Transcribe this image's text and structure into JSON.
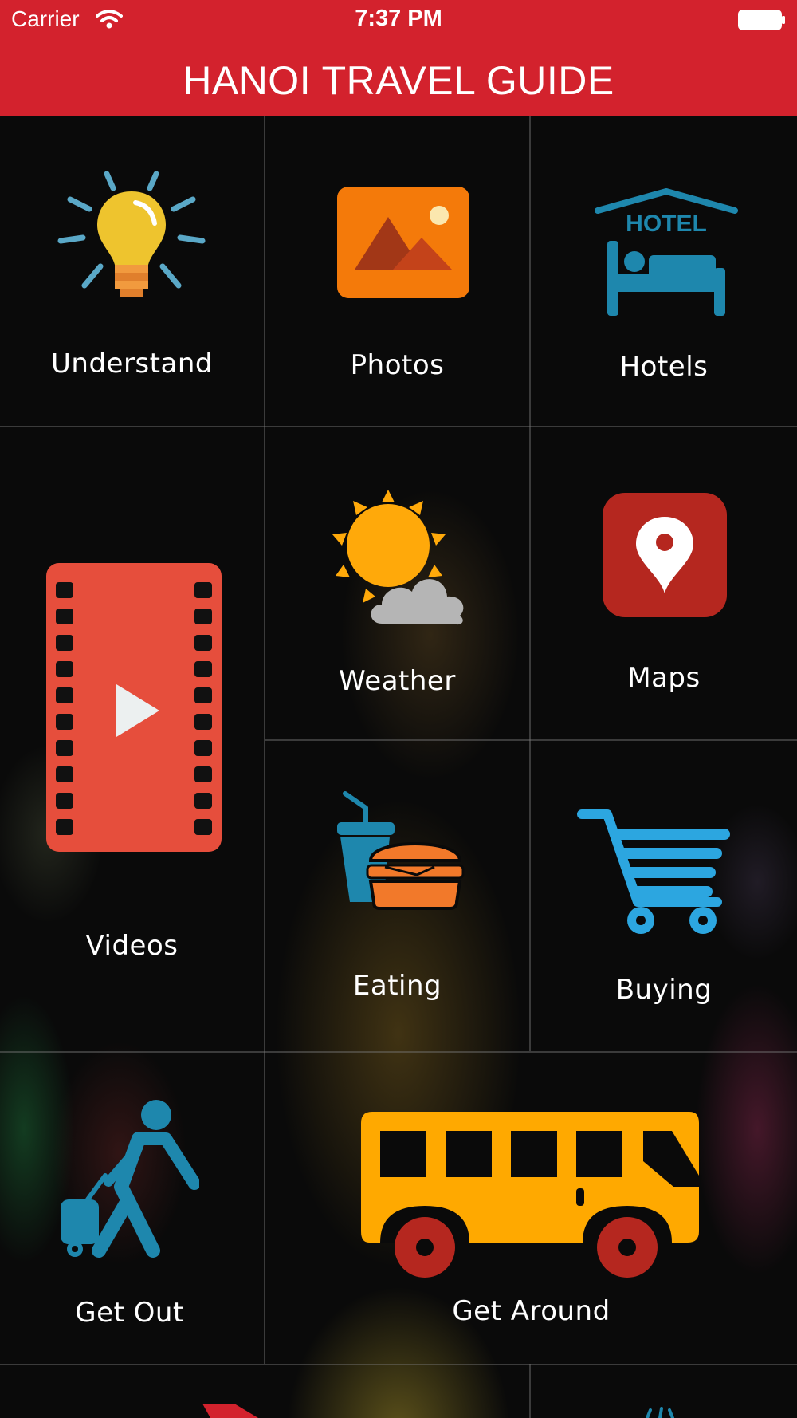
{
  "status_bar": {
    "carrier": "Carrier",
    "time": "7:37 PM"
  },
  "header": {
    "title": "HANOI TRAVEL GUIDE"
  },
  "menu": {
    "understand": "Understand",
    "photos": "Photos",
    "hotels": "Hotels",
    "hotel_sign": "HOTEL",
    "videos": "Videos",
    "weather": "Weather",
    "maps": "Maps",
    "eating": "Eating",
    "buying": "Buying",
    "get_out": "Get Out",
    "get_around": "Get Around"
  },
  "icons": {
    "understand": "lightbulb-icon",
    "photos": "image-icon",
    "hotels": "hotel-bed-icon",
    "videos": "film-play-icon",
    "weather": "sun-cloud-icon",
    "maps": "map-pin-icon",
    "eating": "fast-food-icon",
    "buying": "shopping-cart-icon",
    "get_out": "traveler-icon",
    "get_around": "bus-icon"
  },
  "colors": {
    "brand_red": "#d3222d",
    "bulb_yellow": "#eec42e",
    "photo_orange": "#f47a0a",
    "hotel_blue": "#1e87ad",
    "video_red": "#e64e3c",
    "sun_orange": "#ffa90a",
    "map_red": "#b5271f",
    "food_orange": "#f2792a",
    "cart_blue": "#2ca6e0",
    "bus_yellow": "#ffa900"
  }
}
